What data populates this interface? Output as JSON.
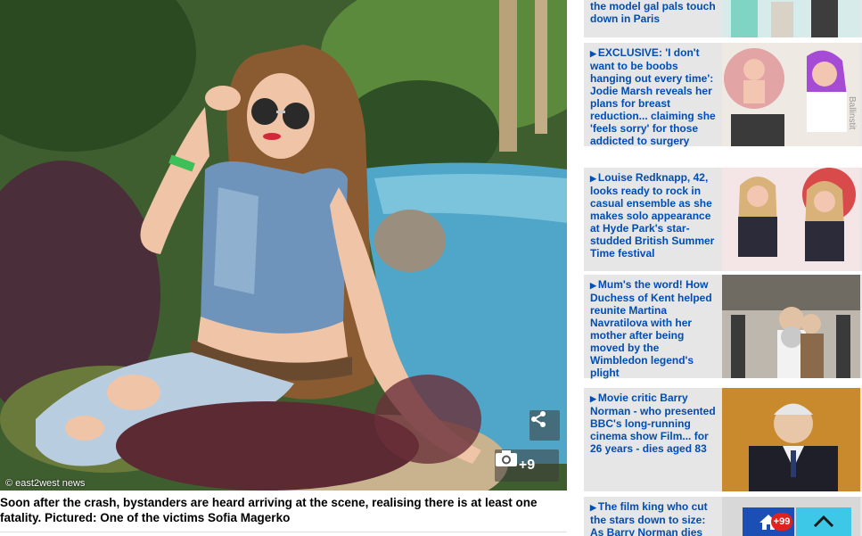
{
  "photo": {
    "credit": "© east2west news",
    "gallery_count": "+9",
    "icons": {
      "share": "share-icon",
      "camera": "camera-icon"
    }
  },
  "caption": "Soon after the crash, bystanders are heard arriving at the scene, realising there is at least one fatality. Pictured: One of the victims Sofia Magerko",
  "sidebar": {
    "items": [
      {
        "title": "the model gal pals touch down in Paris"
      },
      {
        "title": "EXCLUSIVE: 'I don't want to be boobs hanging out every time': Jodie Marsh reveals her plans for breast reduction... claiming she 'feels sorry' for those addicted to surgery"
      },
      {
        "title": "Louise Redknapp, 42, looks ready to rock in casual ensemble as she makes solo appearance at Hyde Park's star-studded British Summer Time festival"
      },
      {
        "title": "Mum's the word! How Duchess of Kent helped reunite Martina Navratilova with her mother after being moved by the Wimbledon legend's plight"
      },
      {
        "title": "Movie critic Barry Norman - who presented BBC's long-running cinema show Film... for 26 years - dies aged 83"
      },
      {
        "title": "The film king who cut the stars down to size: As Barry Norman dies"
      }
    ]
  },
  "floating": {
    "badge": "+99",
    "icons": {
      "home": "home-icon",
      "top": "chevron-up-icon"
    }
  },
  "colors": {
    "link": "#004db3",
    "card_bg": "#e6e6e6",
    "home_btn": "#1b4fb3",
    "top_btn": "#3cc8e6",
    "badge": "#e2211c"
  }
}
